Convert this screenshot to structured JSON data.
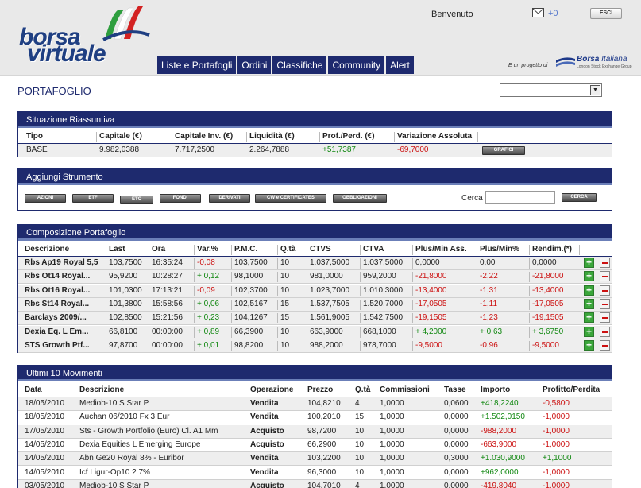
{
  "header": {
    "logo_line1": "borsa",
    "logo_line2": "virtuale",
    "welcome": "Benvenuto",
    "mail_count": "+0",
    "logout": "ESCI",
    "nav": [
      "Liste e Portafogli",
      "Ordini",
      "Classifiche",
      "Community",
      "Alert"
    ],
    "partner_text": "E un progetto di",
    "partner_name": "Borsa",
    "partner_name2": "Italiana",
    "partner_sub": "London Stock Exchange Group"
  },
  "page": {
    "title": "PORTAFOGLIO",
    "select_value": ""
  },
  "summary": {
    "title": "Situazione Riassuntiva",
    "columns": [
      "Tipo",
      "Capitale (€)",
      "Capitale Inv. (€)",
      "Liquidità (€)",
      "Prof./Perd. (€)",
      "Variazione Assoluta"
    ],
    "row": [
      "BASE",
      "9.982,0388",
      "7.717,2500",
      "2.264,7888",
      "+51,7387",
      "-69,7000"
    ],
    "button": "GRAFICI"
  },
  "add": {
    "title": "Aggiungi Strumento",
    "buttons": [
      "AZIONI",
      "ETF",
      "ETC",
      "FONDI",
      "DERIVATI",
      "CW e CERTIFICATES",
      "OBBLIGAZIONI"
    ],
    "search_label": "Cerca",
    "search_value": "",
    "search_button": "CERCA"
  },
  "composition": {
    "title": "Composizione Portafoglio",
    "columns": [
      "Descrizione",
      "Last",
      "Ora",
      "Var.%",
      "P.M.C.",
      "Q.tà",
      "CTVS",
      "CTVA",
      "Plus/Min Ass.",
      "Plus/Min%",
      "Rendim.(*)"
    ],
    "rows": [
      [
        "Rbs Ap19 Royal 5,5",
        "103,7500",
        "16:35:24",
        "-0,08",
        "103,7500",
        "10",
        "1.037,5000",
        "1.037,5000",
        "0,0000",
        "0,00",
        "0,0000"
      ],
      [
        "Rbs Ot14 Royal...",
        "95,9200",
        "10:28:27",
        "+ 0,12",
        "98,1000",
        "10",
        "981,0000",
        "959,2000",
        "-21,8000",
        "-2,22",
        "-21,8000"
      ],
      [
        "Rbs Ot16 Royal...",
        "101,0300",
        "17:13:21",
        "-0,09",
        "102,3700",
        "10",
        "1.023,7000",
        "1.010,3000",
        "-13,4000",
        "-1,31",
        "-13,4000"
      ],
      [
        "Rbs St14 Royal...",
        "101,3800",
        "15:58:56",
        "+ 0,06",
        "102,5167",
        "15",
        "1.537,7505",
        "1.520,7000",
        "-17,0505",
        "-1,11",
        "-17,0505"
      ],
      [
        "Barclays 2009/...",
        "102,8500",
        "15:21:56",
        "+ 0,23",
        "104,1267",
        "15",
        "1.561,9005",
        "1.542,7500",
        "-19,1505",
        "-1,23",
        "-19,1505"
      ],
      [
        "Dexia Eq. L Em...",
        "66,8100",
        "00:00:00",
        "+ 0,89",
        "66,3900",
        "10",
        "663,9000",
        "668,1000",
        "+ 4,2000",
        "+ 0,63",
        "+ 3,6750"
      ],
      [
        "STS Growth Ptf...",
        "97,8700",
        "00:00:00",
        "+ 0,01",
        "98,8200",
        "10",
        "988,2000",
        "978,7000",
        "-9,5000",
        "-0,96",
        "-9,5000"
      ]
    ]
  },
  "movements": {
    "title": "Ultimi 10 Movimenti",
    "columns": [
      "Data",
      "Descrizione",
      "Operazione",
      "Prezzo",
      "Q.tà",
      "Commissioni",
      "Tasse",
      "Importo",
      "Profitto/Perdita"
    ],
    "rows": [
      [
        "18/05/2010",
        "Mediob-10 S Star P",
        "Vendita",
        "104,8210",
        "4",
        "1,0000",
        "0,0600",
        "+418,2240",
        "-0,5800"
      ],
      [
        "18/05/2010",
        "Auchan 06/2010 Fx 3 Eur",
        "Vendita",
        "100,2010",
        "15",
        "1,0000",
        "0,0000",
        "+1.502,0150",
        "-1,0000"
      ],
      [
        "17/05/2010",
        "Sts - Growth Portfolio (Euro) Cl. A1 Mm",
        "Acquisto",
        "98,7200",
        "10",
        "1,0000",
        "0,0000",
        "-988,2000",
        "-1,0000"
      ],
      [
        "14/05/2010",
        "Dexia Equities L Emerging Europe",
        "Acquisto",
        "66,2900",
        "10",
        "1,0000",
        "0,0000",
        "-663,9000",
        "-1,0000"
      ],
      [
        "14/05/2010",
        "Abn Ge20 Royal 8% - Euribor",
        "Vendita",
        "103,2200",
        "10",
        "1,0000",
        "0,3000",
        "+1.030,9000",
        "+1,1000"
      ],
      [
        "14/05/2010",
        "Icf Ligur-Op10 2 7%",
        "Vendita",
        "96,3000",
        "10",
        "1,0000",
        "0,0000",
        "+962,0000",
        "-1,0000"
      ],
      [
        "03/05/2010",
        "Mediob-10 S Star P",
        "Acquisto",
        "104,7010",
        "4",
        "1,0000",
        "0,0000",
        "-419,8040",
        "-1,0000"
      ]
    ]
  },
  "colors": {
    "navy": "#1e2a6e",
    "positive": "#118811",
    "negative": "#cc1111"
  }
}
